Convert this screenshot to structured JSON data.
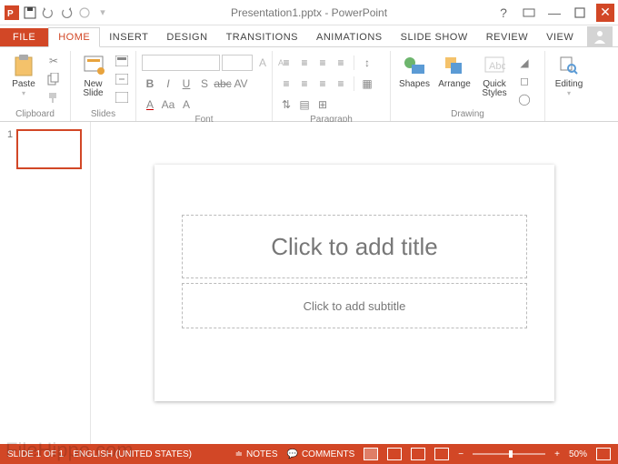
{
  "titlebar": {
    "title": "Presentation1.pptx - PowerPoint"
  },
  "tabs": {
    "file": "FILE",
    "items": [
      "HOME",
      "INSERT",
      "DESIGN",
      "TRANSITIONS",
      "ANIMATIONS",
      "SLIDE SHOW",
      "REVIEW",
      "VIEW"
    ]
  },
  "ribbon": {
    "clipboard": {
      "paste": "Paste",
      "label": "Clipboard"
    },
    "slides": {
      "new_slide": "New\nSlide",
      "label": "Slides"
    },
    "font": {
      "label": "Font"
    },
    "paragraph": {
      "label": "Paragraph"
    },
    "drawing": {
      "shapes": "Shapes",
      "arrange": "Arrange",
      "quick_styles": "Quick\nStyles",
      "label": "Drawing"
    },
    "editing": {
      "editing": "Editing"
    }
  },
  "thumbs": {
    "slide1_num": "1"
  },
  "slide": {
    "title_placeholder": "Click to add title",
    "subtitle_placeholder": "Click to add subtitle"
  },
  "statusbar": {
    "slide_count": "SLIDE 1 OF 1",
    "lang": "ENGLISH (UNITED STATES)",
    "notes": "NOTES",
    "comments": "COMMENTS",
    "zoom": "50%"
  },
  "watermark": "FileHippo.com"
}
